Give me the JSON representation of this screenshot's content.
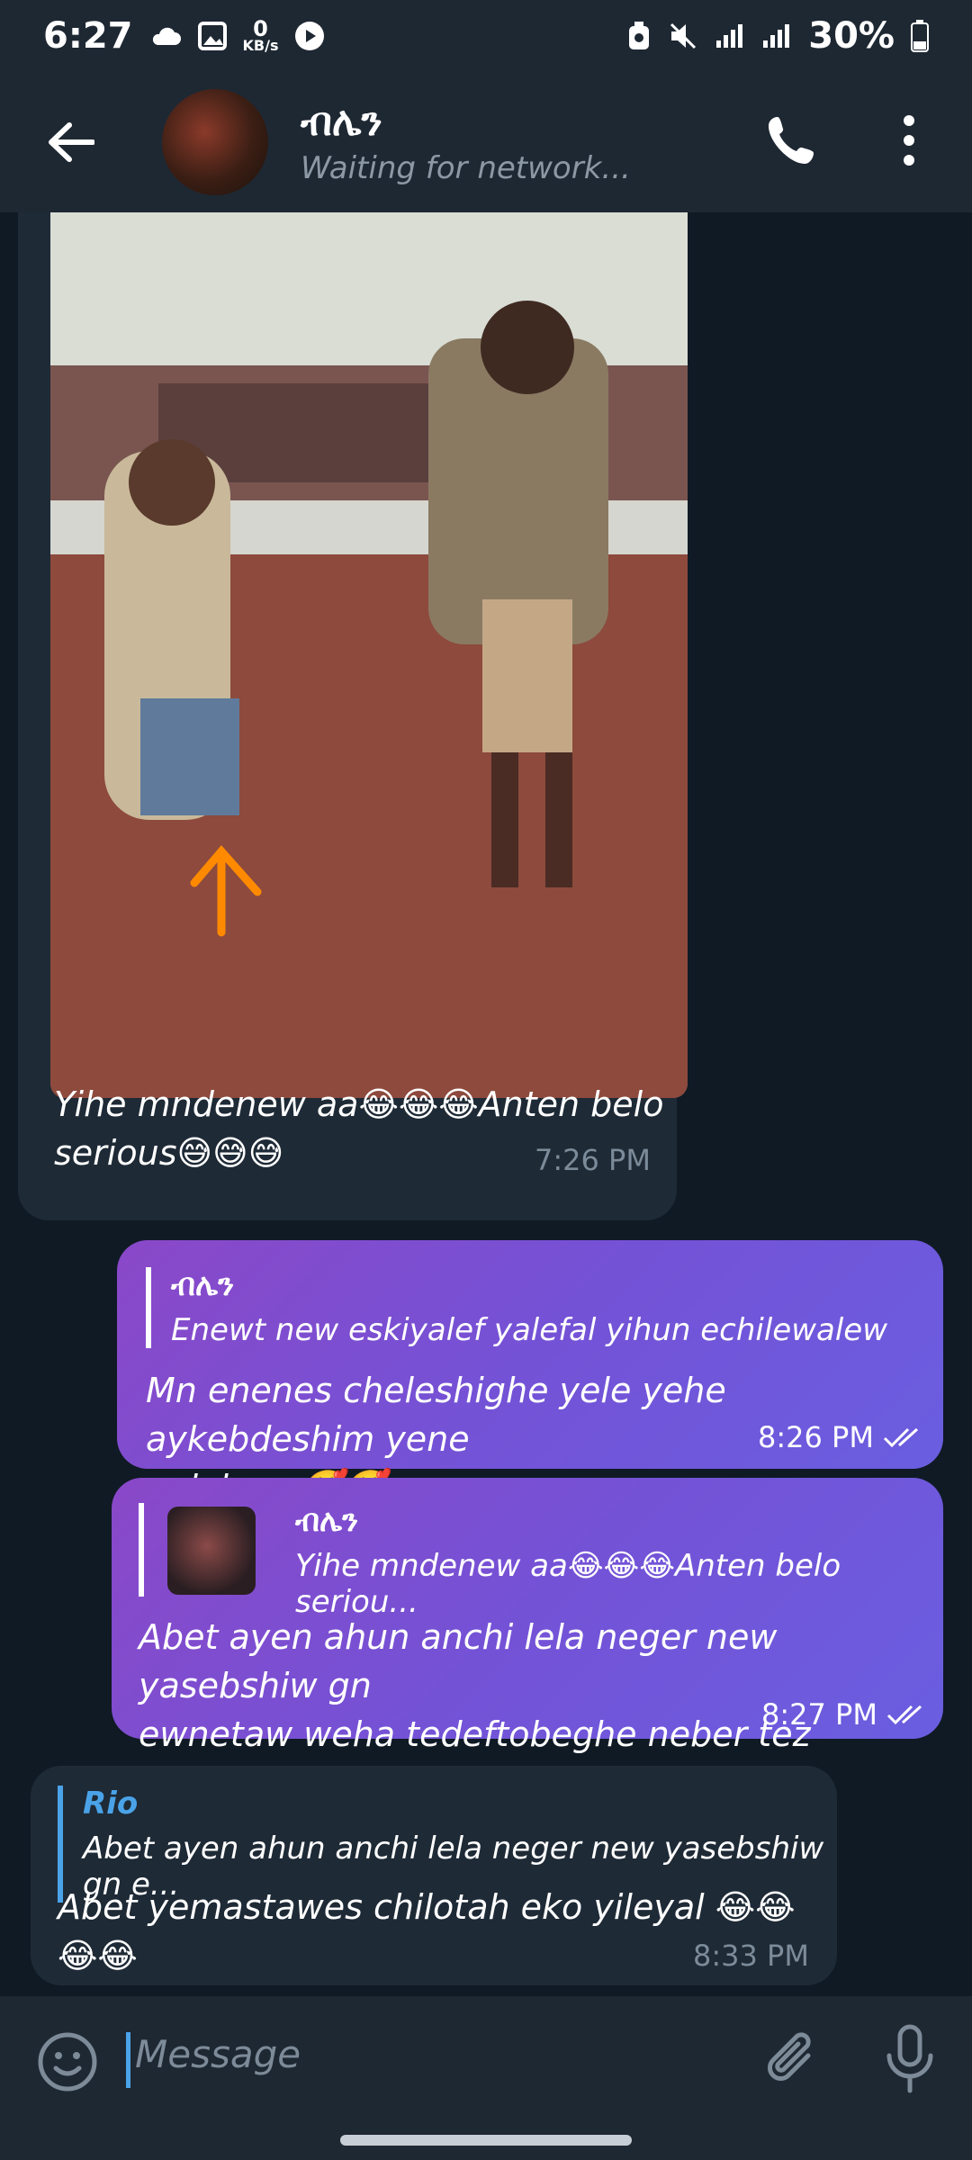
{
  "status_bar": {
    "time": "6:27",
    "data_speed_value": "0",
    "data_speed_unit": "KB/s",
    "battery": "30%"
  },
  "header": {
    "contact_name": "ብሌን",
    "status": "Waiting for network..."
  },
  "messages": [
    {
      "direction": "incoming",
      "has_photo": true,
      "text_line1": "Yihe mndenew aa😂😂😂Anten belo",
      "text_line2": "serious😅😅😅",
      "time": "7:26 PM"
    },
    {
      "direction": "outgoing",
      "reply_name": "ብሌን",
      "reply_text": "Enewt new eskiyalef yalefal yihun echilewalew",
      "text_line1": "Mn enenes cheleshighe yele yehe aykebdeshim yene",
      "text_line2": "qelal nw 🥰🥰",
      "time": "8:26 PM"
    },
    {
      "direction": "outgoing",
      "reply_name": "ብሌን",
      "reply_text": "Yihe mndenew aa😂😂😂Anten belo seriou...",
      "text_line1": "Abet ayen ahun anchi lela neger new yasebshiw gn",
      "text_line2": "ewnetaw weha tedeftobeghe neber tez yileghal",
      "time": "8:27 PM"
    },
    {
      "direction": "incoming",
      "reply_name": "Rio",
      "reply_text": "Abet ayen ahun anchi lela neger new yasebshiw gn e...",
      "text_line1": "Abet yemastawes chilotah eko yileyal 😂😂😂😂",
      "time": "8:33 PM"
    }
  ],
  "composer": {
    "placeholder": "Message"
  },
  "colors": {
    "background": "#0f1a25",
    "bar": "#1e2833",
    "incoming_bubble": "#1e2a36",
    "outgoing_gradient_start": "#8a48c8",
    "outgoing_gradient_end": "#6a5ee0",
    "reply_name_incoming": "#4aa3e8"
  }
}
